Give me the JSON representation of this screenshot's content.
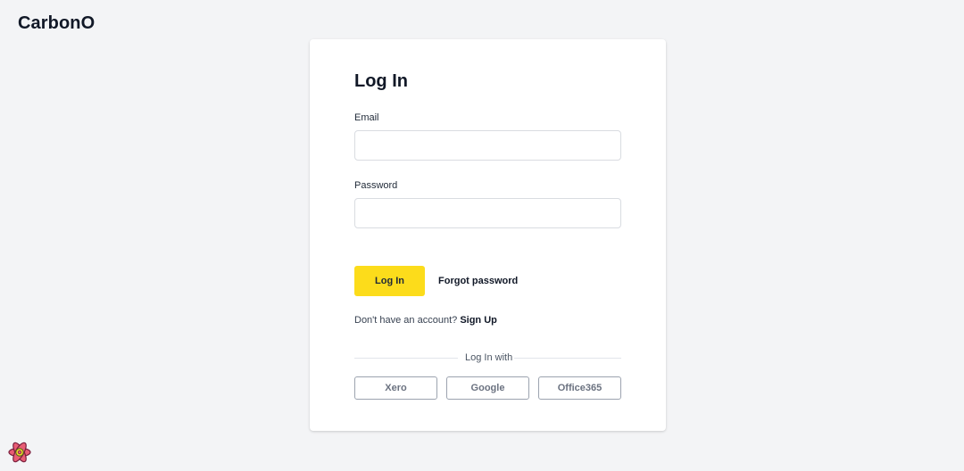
{
  "header": {
    "brand": "CarbonO"
  },
  "login_card": {
    "title": "Log In",
    "email_label": "Email",
    "email_value": "",
    "password_label": "Password",
    "password_value": "",
    "submit_label": "Log In",
    "forgot_label": "Forgot password",
    "signup_prompt": "Don't have an account?",
    "signup_link": "Sign Up",
    "divider_label": "Log In with",
    "sso_buttons": [
      {
        "label": "Xero"
      },
      {
        "label": "Google"
      },
      {
        "label": "Office365"
      }
    ]
  },
  "colors": {
    "page_background": "#f3f4f6",
    "card_background": "#ffffff",
    "primary_button": "#fcdc1b",
    "text_dark": "#111827",
    "sso_border": "#9ca3af"
  },
  "icons": {
    "dev_tools": "react-logo-icon"
  }
}
